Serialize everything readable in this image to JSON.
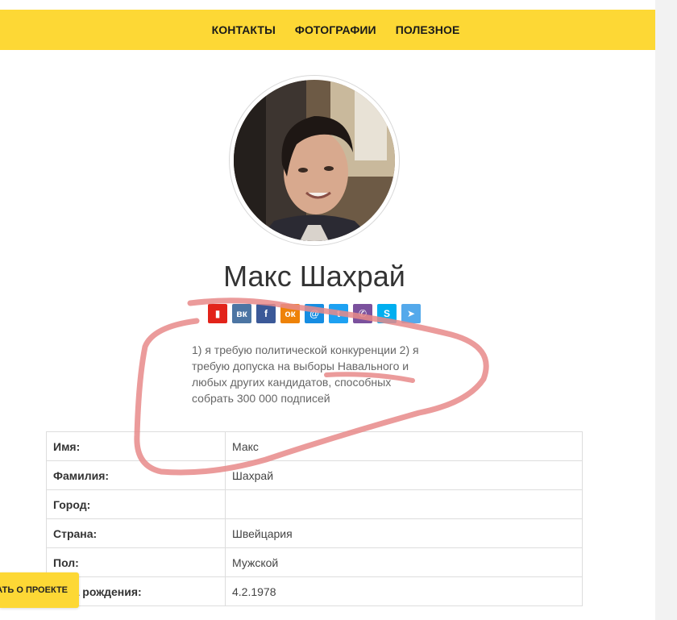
{
  "nav": {
    "items": [
      {
        "label": "КОНТАКТЫ"
      },
      {
        "label": "ФОТОГРАФИИ"
      },
      {
        "label": "ПОЛЕЗНОЕ"
      }
    ]
  },
  "profile": {
    "name": "Макс Шахрай",
    "bio": "1) я требую политической конкуренции 2) я требую допуска на выборы Навального и любых других кандидатов, способных собрать 300 000 подписей"
  },
  "social": [
    {
      "icon": "bookmark-icon",
      "glyph": "▮",
      "color": "#e2231a"
    },
    {
      "icon": "vk-icon",
      "glyph": "вк",
      "color": "#4c75a3"
    },
    {
      "icon": "facebook-icon",
      "glyph": "f",
      "color": "#3b5998"
    },
    {
      "icon": "odnoklassniki-icon",
      "glyph": "ок",
      "color": "#ee8208"
    },
    {
      "icon": "moimir-icon",
      "glyph": "@",
      "color": "#168de2"
    },
    {
      "icon": "twitter-icon",
      "glyph": "t",
      "color": "#1da1f2"
    },
    {
      "icon": "viber-icon",
      "glyph": "✆",
      "color": "#7b519d"
    },
    {
      "icon": "skype-icon",
      "glyph": "S",
      "color": "#00aff0"
    },
    {
      "icon": "telegram-icon",
      "glyph": "➤",
      "color": "#54a9eb"
    }
  ],
  "table": [
    {
      "label": "Имя:",
      "value": "Макс"
    },
    {
      "label": "Фамилия:",
      "value": "Шахрай"
    },
    {
      "label": "Город:",
      "value": ""
    },
    {
      "label": "Страна:",
      "value": "Швейцария"
    },
    {
      "label": "Пол:",
      "value": "Мужской"
    },
    {
      "label": "Дата рождения:",
      "value": "4.2.1978"
    }
  ],
  "about_button": {
    "label": "РАССКАЗАТЬ О ПРОЕКТЕ"
  },
  "colors": {
    "accent": "#fdd835",
    "annotation": "#e88a8a"
  }
}
